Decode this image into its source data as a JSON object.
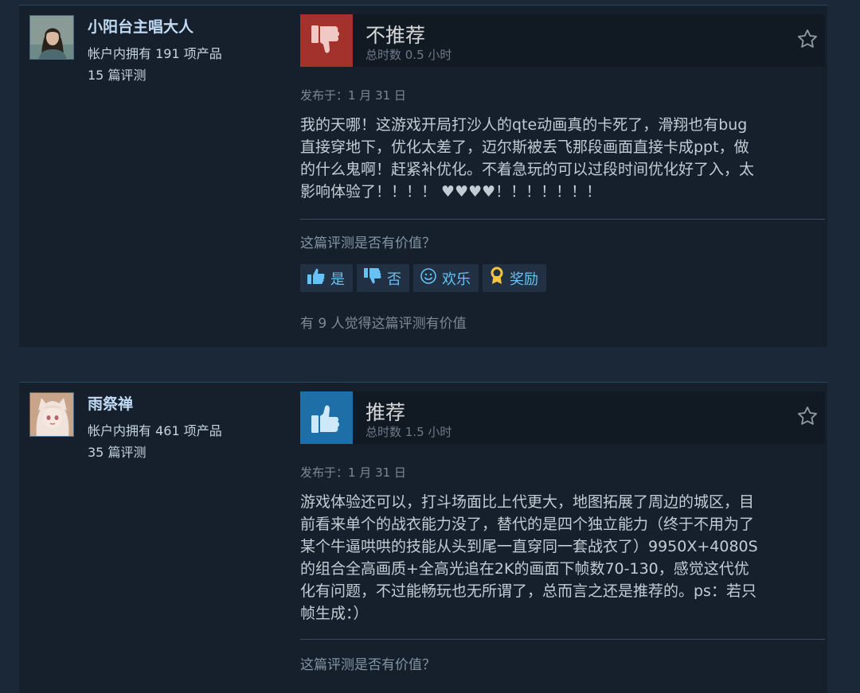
{
  "reviews": [
    {
      "user": {
        "name": "小阳台主唱大人",
        "products": "帐户内拥有 191 项产品",
        "review_count": "15 篇评测"
      },
      "verdict": "不推荐",
      "verdict_type": "not-recommended",
      "playtime": "总时数 0.5 小时",
      "posted": "发布于：1 月 31 日",
      "body_lines": [
        "我的天哪！这游戏开局打沙人的qte动画真的卡死了，滑翔也有bug",
        "直接穿地下，优化太差了，迈尔斯被丢飞那段画面直接卡成ppt，做",
        "的什么鬼啊！赶紧补优化。不着急玩的可以过段时间优化好了入，太",
        "影响体验了！！！！ ♥♥♥♥！！！！！！！"
      ],
      "helpful_question": "这篇评测是否有价值？",
      "buttons": {
        "yes": "是",
        "no": "否",
        "funny": "欢乐",
        "award": "奖励"
      },
      "helpful_count": "有 9 人觉得这篇评测有价值"
    },
    {
      "user": {
        "name": "雨祭禅",
        "products": "帐户内拥有 461 项产品",
        "review_count": "35 篇评测"
      },
      "verdict": "推荐",
      "verdict_type": "recommended",
      "playtime": "总时数 1.5 小时",
      "posted": "发布于：1 月 31 日",
      "body_lines": [
        "游戏体验还可以，打斗场面比上代更大，地图拓展了周边的城区，目",
        "前看来单个的战衣能力没了，替代的是四个独立能力（终于不用为了",
        "某个牛逼哄哄的技能从头到尾一直穿同一套战衣了）9950X+4080S",
        "的组合全高画质+全高光追在2K的画面下帧数70-130，感觉这代优",
        "化有问题，不过能畅玩也无所谓了，总而言之还是推荐的。ps：若只",
        "帧生成：）"
      ],
      "helpful_question": "这篇评测是否有价值？"
    }
  ],
  "colors": {
    "background": "#1b2838",
    "card": "#16202d",
    "link": "#67c1f5",
    "thumb_down": "#a3312c",
    "thumb_up": "#1e6fa8"
  }
}
